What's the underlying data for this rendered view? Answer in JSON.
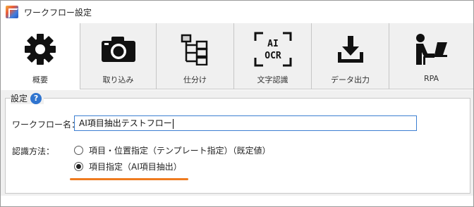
{
  "window": {
    "title": "ワークフロー設定"
  },
  "tabs": [
    {
      "label": "概要",
      "icon": "gear-icon",
      "active": true
    },
    {
      "label": "取り込み",
      "icon": "camera-icon",
      "active": false
    },
    {
      "label": "仕分け",
      "icon": "sort-tree-icon",
      "active": false
    },
    {
      "label": "文字認識",
      "icon": "ai-ocr-icon",
      "icon_text_top": "AI",
      "icon_text_bottom": "OCR",
      "active": false
    },
    {
      "label": "データ出力",
      "icon": "download-icon",
      "active": false
    },
    {
      "label": "RPA",
      "icon": "person-at-computer-icon",
      "active": false
    }
  ],
  "settings": {
    "group_title": "設定",
    "help_glyph": "?",
    "workflow_name_label": "ワークフロー名：",
    "workflow_name_value": "AI項目抽出テストフロー",
    "recognition_method_label": "認識方法：",
    "options": [
      {
        "label": "項目・位置指定（テンプレート指定）（既定値）",
        "checked": false
      },
      {
        "label": "項目指定（AI項目抽出）",
        "checked": true
      }
    ]
  },
  "colors": {
    "accent_underline": "#ef7b1f",
    "input_border": "#3c7fd1",
    "help_icon": "#2f74cf"
  }
}
